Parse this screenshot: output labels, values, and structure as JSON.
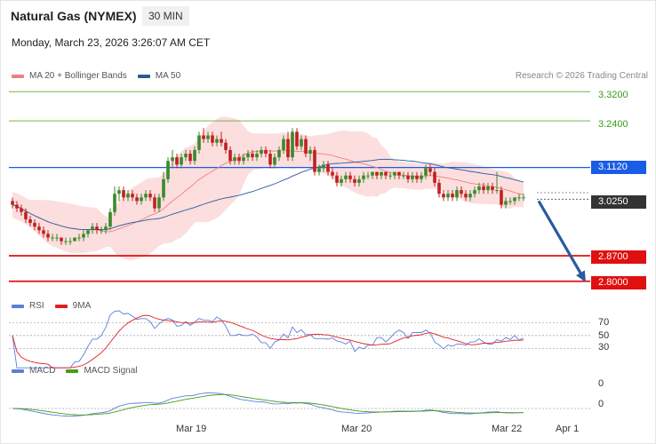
{
  "header": {
    "title": "Natural Gas (NYMEX)",
    "timeframe": "30 MIN",
    "datetime": "Monday, March 23, 2026 3:26:07 AM CET",
    "credit": "Research © 2026 Trading Central"
  },
  "legends": {
    "price": [
      {
        "label": "MA 20 + Bollinger Bands",
        "color": "#f08080"
      },
      {
        "label": "MA 50",
        "color": "#2b5a9e"
      }
    ],
    "rsi": [
      {
        "label": "RSI",
        "color": "#5b7fdb"
      },
      {
        "label": "9MA",
        "color": "#e02020"
      }
    ],
    "macd": [
      {
        "label": "MACD",
        "color": "#5b7fdb"
      },
      {
        "label": "MACD Signal",
        "color": "#4a9a1a"
      }
    ]
  },
  "colors": {
    "resistance": "#1a5ce6",
    "support": "#e01010",
    "target": "#7ab04a",
    "current": "#333333",
    "bull": "#3a8a2a",
    "bear": "#c02020",
    "arrow": "#2b5a9e"
  },
  "price_levels": {
    "targets": [
      "3.3200",
      "3.2400"
    ],
    "resistance": "3.1120",
    "current": "3.0250",
    "supports": [
      "2.8700",
      "2.8000"
    ]
  },
  "rsi_levels": [
    "70",
    "50",
    "30"
  ],
  "macd_levels": [
    "0",
    "0"
  ],
  "x_axis": [
    "Mar 19",
    "Mar 20",
    "Mar 22",
    "Apr 1"
  ],
  "chart_data": {
    "type": "candlestick",
    "title": "Natural Gas (NYMEX)",
    "timeframe": "30 MIN",
    "ylim": [
      2.78,
      3.34
    ],
    "x_ticks": [
      "Mar 19",
      "Mar 20",
      "Mar 22",
      "Apr 1"
    ],
    "candles": [
      [
        3.02,
        3.03,
        3.0,
        3.01
      ],
      [
        3.01,
        3.02,
        2.99,
        3.0
      ],
      [
        3.0,
        3.01,
        2.98,
        2.99
      ],
      [
        2.99,
        3.0,
        2.96,
        2.97
      ],
      [
        2.97,
        2.98,
        2.95,
        2.96
      ],
      [
        2.96,
        2.97,
        2.94,
        2.95
      ],
      [
        2.95,
        2.96,
        2.93,
        2.94
      ],
      [
        2.94,
        2.95,
        2.92,
        2.93
      ],
      [
        2.93,
        2.94,
        2.91,
        2.92
      ],
      [
        2.92,
        2.93,
        2.91,
        2.92
      ],
      [
        2.92,
        2.93,
        2.91,
        2.92
      ],
      [
        2.92,
        2.92,
        2.9,
        2.91
      ],
      [
        2.91,
        2.92,
        2.9,
        2.91
      ],
      [
        2.91,
        2.92,
        2.9,
        2.91
      ],
      [
        2.91,
        2.92,
        2.91,
        2.92
      ],
      [
        2.92,
        2.93,
        2.91,
        2.92
      ],
      [
        2.92,
        2.94,
        2.91,
        2.93
      ],
      [
        2.93,
        2.94,
        2.92,
        2.94
      ],
      [
        2.94,
        2.96,
        2.93,
        2.95
      ],
      [
        2.95,
        2.96,
        2.93,
        2.94
      ],
      [
        2.94,
        2.95,
        2.93,
        2.94
      ],
      [
        2.94,
        2.96,
        2.93,
        2.95
      ],
      [
        2.95,
        3.0,
        2.94,
        2.99
      ],
      [
        2.99,
        3.06,
        2.98,
        3.04
      ],
      [
        3.04,
        3.06,
        3.02,
        3.05
      ],
      [
        3.05,
        3.06,
        3.02,
        3.03
      ],
      [
        3.03,
        3.05,
        3.02,
        3.04
      ],
      [
        3.04,
        3.05,
        3.02,
        3.03
      ],
      [
        3.03,
        3.04,
        3.01,
        3.02
      ],
      [
        3.02,
        3.04,
        3.01,
        3.03
      ],
      [
        3.03,
        3.05,
        3.02,
        3.04
      ],
      [
        3.04,
        3.05,
        3.02,
        3.03
      ],
      [
        3.03,
        3.04,
        2.99,
        3.0
      ],
      [
        3.0,
        3.04,
        2.99,
        3.03
      ],
      [
        3.03,
        3.1,
        3.02,
        3.08
      ],
      [
        3.08,
        3.14,
        3.07,
        3.13
      ],
      [
        3.13,
        3.16,
        3.11,
        3.14
      ],
      [
        3.14,
        3.15,
        3.11,
        3.12
      ],
      [
        3.12,
        3.15,
        3.11,
        3.14
      ],
      [
        3.14,
        3.16,
        3.13,
        3.15
      ],
      [
        3.15,
        3.16,
        3.12,
        3.13
      ],
      [
        3.13,
        3.17,
        3.12,
        3.16
      ],
      [
        3.16,
        3.21,
        3.15,
        3.2
      ],
      [
        3.2,
        3.22,
        3.18,
        3.19
      ],
      [
        3.19,
        3.21,
        3.18,
        3.2
      ],
      [
        3.2,
        3.21,
        3.17,
        3.18
      ],
      [
        3.18,
        3.2,
        3.17,
        3.19
      ],
      [
        3.19,
        3.21,
        3.17,
        3.18
      ],
      [
        3.18,
        3.19,
        3.15,
        3.16
      ],
      [
        3.16,
        3.17,
        3.12,
        3.13
      ],
      [
        3.13,
        3.15,
        3.12,
        3.14
      ],
      [
        3.14,
        3.15,
        3.12,
        3.13
      ],
      [
        3.13,
        3.15,
        3.12,
        3.14
      ],
      [
        3.14,
        3.16,
        3.13,
        3.15
      ],
      [
        3.15,
        3.16,
        3.13,
        3.14
      ],
      [
        3.14,
        3.16,
        3.13,
        3.15
      ],
      [
        3.15,
        3.17,
        3.14,
        3.16
      ],
      [
        3.16,
        3.17,
        3.14,
        3.15
      ],
      [
        3.15,
        3.16,
        3.11,
        3.12
      ],
      [
        3.12,
        3.15,
        3.11,
        3.14
      ],
      [
        3.14,
        3.17,
        3.13,
        3.16
      ],
      [
        3.16,
        3.2,
        3.15,
        3.19
      ],
      [
        3.19,
        3.21,
        3.13,
        3.14
      ],
      [
        3.14,
        3.22,
        3.13,
        3.21
      ],
      [
        3.21,
        3.22,
        3.16,
        3.17
      ],
      [
        3.17,
        3.2,
        3.16,
        3.19
      ],
      [
        3.19,
        3.2,
        3.14,
        3.15
      ],
      [
        3.15,
        3.17,
        3.13,
        3.16
      ],
      [
        3.16,
        3.17,
        3.09,
        3.1
      ],
      [
        3.1,
        3.12,
        3.09,
        3.11
      ],
      [
        3.11,
        3.13,
        3.1,
        3.12
      ],
      [
        3.12,
        3.13,
        3.09,
        3.1
      ],
      [
        3.1,
        3.11,
        3.08,
        3.09
      ],
      [
        3.09,
        3.1,
        3.06,
        3.07
      ],
      [
        3.07,
        3.09,
        3.06,
        3.08
      ],
      [
        3.08,
        3.1,
        3.07,
        3.09
      ],
      [
        3.09,
        3.1,
        3.07,
        3.08
      ],
      [
        3.08,
        3.09,
        3.06,
        3.07
      ],
      [
        3.07,
        3.09,
        3.06,
        3.08
      ],
      [
        3.08,
        3.1,
        3.07,
        3.09
      ],
      [
        3.09,
        3.1,
        3.08,
        3.09
      ],
      [
        3.09,
        3.1,
        3.08,
        3.1
      ],
      [
        3.1,
        3.1,
        3.08,
        3.09
      ],
      [
        3.09,
        3.1,
        3.08,
        3.1
      ],
      [
        3.1,
        3.1,
        3.08,
        3.09
      ],
      [
        3.09,
        3.1,
        3.08,
        3.09
      ],
      [
        3.09,
        3.1,
        3.08,
        3.1
      ],
      [
        3.1,
        3.1,
        3.08,
        3.09
      ],
      [
        3.09,
        3.1,
        3.08,
        3.09
      ],
      [
        3.09,
        3.1,
        3.07,
        3.08
      ],
      [
        3.08,
        3.1,
        3.07,
        3.09
      ],
      [
        3.09,
        3.1,
        3.07,
        3.08
      ],
      [
        3.08,
        3.1,
        3.07,
        3.09
      ],
      [
        3.09,
        3.12,
        3.08,
        3.11
      ],
      [
        3.11,
        3.12,
        3.09,
        3.1
      ],
      [
        3.1,
        3.11,
        3.06,
        3.07
      ],
      [
        3.07,
        3.08,
        3.03,
        3.04
      ],
      [
        3.04,
        3.05,
        3.02,
        3.03
      ],
      [
        3.03,
        3.05,
        3.02,
        3.04
      ],
      [
        3.04,
        3.05,
        3.02,
        3.03
      ],
      [
        3.03,
        3.06,
        3.02,
        3.05
      ],
      [
        3.05,
        3.06,
        3.03,
        3.04
      ],
      [
        3.04,
        3.05,
        3.02,
        3.03
      ],
      [
        3.03,
        3.05,
        3.02,
        3.04
      ],
      [
        3.04,
        3.06,
        3.03,
        3.05
      ],
      [
        3.05,
        3.07,
        3.04,
        3.06
      ],
      [
        3.06,
        3.07,
        3.04,
        3.05
      ],
      [
        3.05,
        3.07,
        3.04,
        3.06
      ],
      [
        3.06,
        3.07,
        3.04,
        3.05
      ],
      [
        3.05,
        3.1,
        3.04,
        3.05
      ],
      [
        3.05,
        3.06,
        3.0,
        3.01
      ],
      [
        3.01,
        3.03,
        3.0,
        3.02
      ],
      [
        3.02,
        3.03,
        3.01,
        3.02
      ],
      [
        3.02,
        3.03,
        3.01,
        3.03
      ],
      [
        3.03,
        3.04,
        3.02,
        3.03
      ],
      [
        3.03,
        3.04,
        3.02,
        3.03
      ]
    ],
    "series": [
      {
        "name": "MA 20 + Bollinger Bands",
        "type": "line"
      },
      {
        "name": "MA 50",
        "type": "line"
      }
    ],
    "levels": {
      "resistance": [
        3.112
      ],
      "supports": [
        2.87,
        2.8
      ],
      "targets": [
        3.32,
        3.24
      ],
      "current": 3.025
    },
    "forecast_arrow": {
      "from": 3.025,
      "to": 2.8
    },
    "rsi": {
      "levels": [
        70,
        50,
        30
      ],
      "series": [
        "RSI",
        "9MA"
      ]
    },
    "macd": {
      "levels": [
        0,
        0
      ],
      "series": [
        "MACD",
        "MACD Signal"
      ]
    }
  }
}
